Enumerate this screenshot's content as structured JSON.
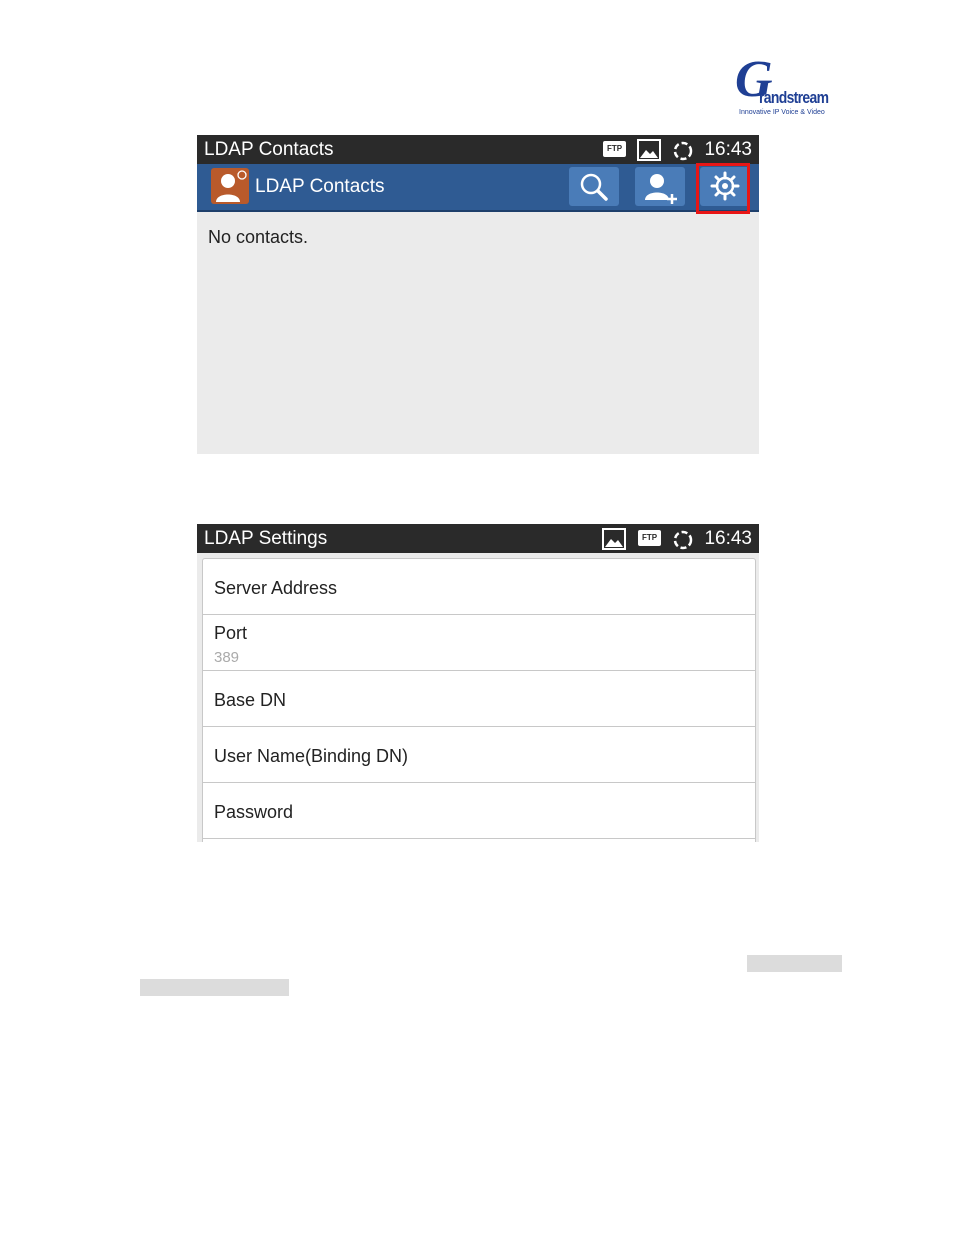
{
  "logo": {
    "letter": "G",
    "word": "randstream",
    "tagline": "Innovative IP Voice & Video"
  },
  "screen1": {
    "status_title": "LDAP Contacts",
    "ftp_badge": "FTP",
    "time": "16:43",
    "actionbar_title": "LDAP Contacts",
    "empty_text": "No contacts.",
    "highlight_color": "#e81616",
    "actionbar_color": "#2f5b93"
  },
  "screen2": {
    "status_title": "LDAP Settings",
    "ftp_badge": "FTP",
    "time": "16:43",
    "items": [
      {
        "label": "Server Address",
        "value": ""
      },
      {
        "label": "Port",
        "value": "389"
      },
      {
        "label": "Base DN",
        "value": ""
      },
      {
        "label": "User Name(Binding DN)",
        "value": ""
      },
      {
        "label": "Password",
        "value": ""
      }
    ]
  }
}
